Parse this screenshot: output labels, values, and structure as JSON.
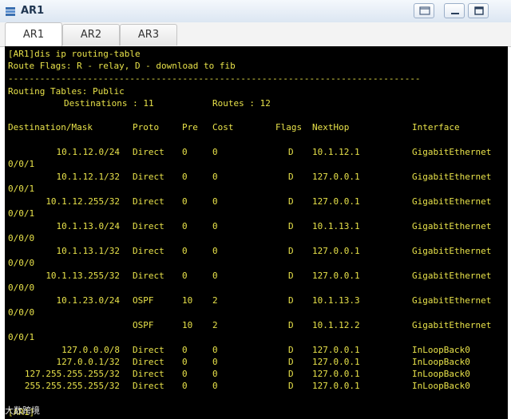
{
  "window": {
    "title": "AR1"
  },
  "tabs": [
    {
      "label": "AR1"
    },
    {
      "label": "AR2"
    },
    {
      "label": "AR3"
    }
  ],
  "terminal": {
    "command": "[AR1]dis ip routing-table",
    "flags_line": "Route Flags: R - relay, D - download to fib",
    "separator": "------------------------------------------------------------------------------",
    "tables_line": "Routing Tables: Public",
    "dest_label": "Destinations : 11",
    "routes_label": "Routes : 12",
    "headers": {
      "dest": "Destination/Mask",
      "proto": "Proto",
      "pre": "Pre",
      "cost": "Cost",
      "flags": "Flags",
      "nexthop": "NextHop",
      "iface": "Interface"
    },
    "routes": [
      {
        "dest": "10.1.12.0/24",
        "proto": "Direct",
        "pre": "0",
        "cost": "0",
        "flags": "D",
        "nexthop": "10.1.12.1",
        "iface": "GigabitEthernet",
        "iface_cont": "0/0/1"
      },
      {
        "dest": "10.1.12.1/32",
        "proto": "Direct",
        "pre": "0",
        "cost": "0",
        "flags": "D",
        "nexthop": "127.0.0.1",
        "iface": "GigabitEthernet",
        "iface_cont": "0/0/1"
      },
      {
        "dest": "10.1.12.255/32",
        "proto": "Direct",
        "pre": "0",
        "cost": "0",
        "flags": "D",
        "nexthop": "127.0.0.1",
        "iface": "GigabitEthernet",
        "iface_cont": "0/0/1"
      },
      {
        "dest": "10.1.13.0/24",
        "proto": "Direct",
        "pre": "0",
        "cost": "0",
        "flags": "D",
        "nexthop": "10.1.13.1",
        "iface": "GigabitEthernet",
        "iface_cont": "0/0/0"
      },
      {
        "dest": "10.1.13.1/32",
        "proto": "Direct",
        "pre": "0",
        "cost": "0",
        "flags": "D",
        "nexthop": "127.0.0.1",
        "iface": "GigabitEthernet",
        "iface_cont": "0/0/0"
      },
      {
        "dest": "10.1.13.255/32",
        "proto": "Direct",
        "pre": "0",
        "cost": "0",
        "flags": "D",
        "nexthop": "127.0.0.1",
        "iface": "GigabitEthernet",
        "iface_cont": "0/0/0"
      },
      {
        "dest": "10.1.23.0/24",
        "proto": "OSPF",
        "pre": "10",
        "cost": "2",
        "flags": "D",
        "nexthop": "10.1.13.3",
        "iface": "GigabitEthernet",
        "iface_cont": "0/0/0"
      },
      {
        "dest": "",
        "proto": "OSPF",
        "pre": "10",
        "cost": "2",
        "flags": "D",
        "nexthop": "10.1.12.2",
        "iface": "GigabitEthernet",
        "iface_cont": "0/0/1"
      },
      {
        "dest": "127.0.0.0/8",
        "proto": "Direct",
        "pre": "0",
        "cost": "0",
        "flags": "D",
        "nexthop": "127.0.0.1",
        "iface": "InLoopBack0"
      },
      {
        "dest": "127.0.0.1/32",
        "proto": "Direct",
        "pre": "0",
        "cost": "0",
        "flags": "D",
        "nexthop": "127.0.0.1",
        "iface": "InLoopBack0"
      },
      {
        "dest": "127.255.255.255/32",
        "proto": "Direct",
        "pre": "0",
        "cost": "0",
        "flags": "D",
        "nexthop": "127.0.0.1",
        "iface": "InLoopBack0"
      },
      {
        "dest": "255.255.255.255/32",
        "proto": "Direct",
        "pre": "0",
        "cost": "0",
        "flags": "D",
        "nexthop": "127.0.0.1",
        "iface": "InLoopBack0"
      }
    ],
    "prompt": "[AR1]"
  },
  "watermark": "大数跨境",
  "icons": {
    "app": "network-device-icon",
    "restore": "restore-icon",
    "minimize": "minimize-icon",
    "maximize": "maximize-icon"
  },
  "colors": {
    "terminal_bg": "#000000",
    "terminal_text": "#e8e24a",
    "titlebar": "#dce6f2"
  }
}
